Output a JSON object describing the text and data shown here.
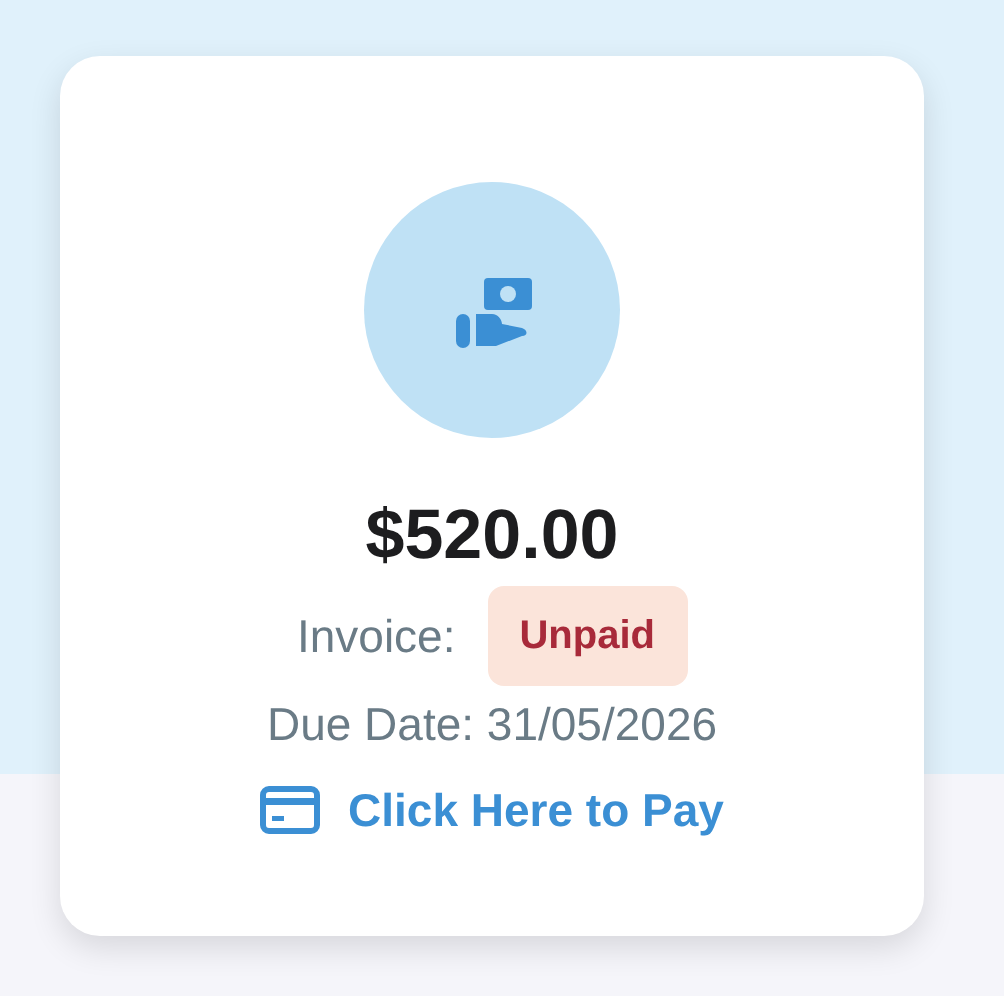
{
  "invoice": {
    "amount": "$520.00",
    "label": "Invoice:",
    "status": {
      "label": "Unpaid",
      "kind": "unpaid"
    },
    "due_date": "Due Date: 31/05/2026",
    "pay_link": "Click Here to Pay"
  }
}
